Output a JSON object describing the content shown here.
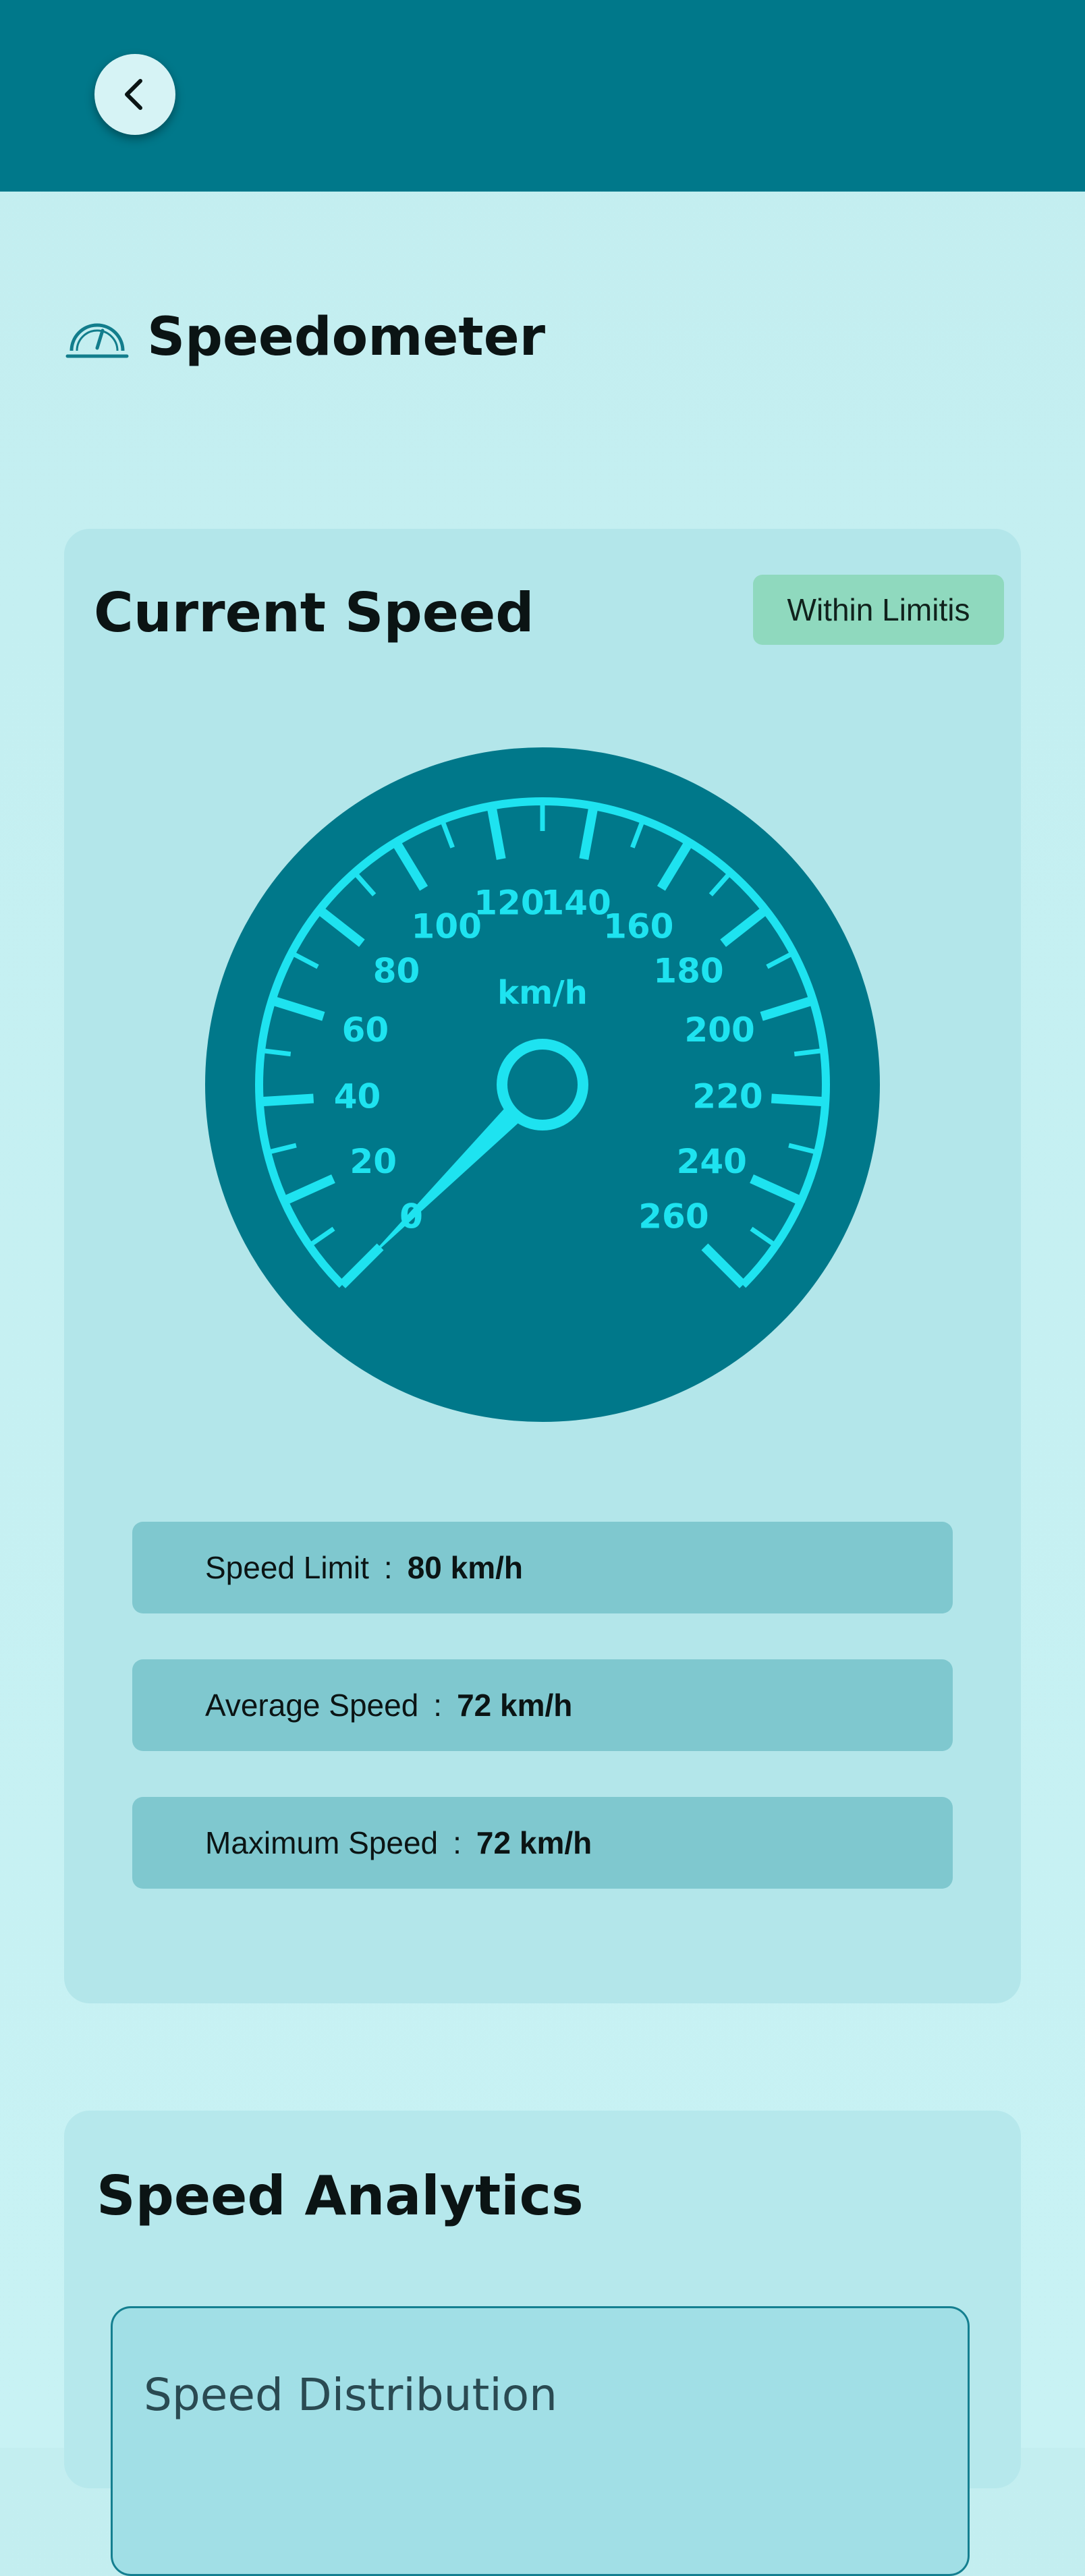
{
  "header": {
    "back_icon": "chevron-left-icon"
  },
  "page": {
    "title": "Speedometer",
    "icon": "speedometer-icon"
  },
  "current_speed": {
    "title": "Current Speed",
    "status_badge": "Within Limitis",
    "gauge": {
      "unit": "km/h",
      "min": 0,
      "max": 260,
      "major_step": 20,
      "needle_value": 0,
      "tick_labels": [
        "0",
        "20",
        "40",
        "60",
        "80",
        "100",
        "120",
        "140",
        "160",
        "180",
        "200",
        "220",
        "240",
        "260"
      ]
    },
    "stats": [
      {
        "label": "Speed Limit",
        "sep": ":",
        "value": "80 km/h"
      },
      {
        "label": "Average Speed",
        "sep": ":",
        "value": "72 km/h"
      },
      {
        "label": "Maximum Speed",
        "sep": ":",
        "value": "72 km/h"
      }
    ]
  },
  "analytics": {
    "title": "Speed Analytics",
    "distribution_title": "Speed Distribution"
  },
  "colors": {
    "topbar": "#00788a",
    "gauge_face": "#00788a",
    "gauge_ink": "#1ee3f0",
    "badge": "#8fd9be"
  }
}
